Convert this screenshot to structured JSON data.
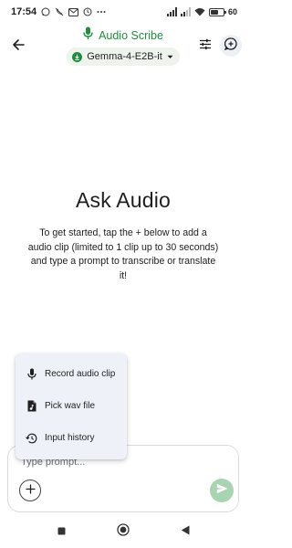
{
  "status_bar": {
    "time": "17:54",
    "battery_value": "60",
    "battery_level": 0.6,
    "icons": [
      "whatsapp-icon",
      "phone-off-icon",
      "gmail-icon",
      "clock-icon",
      "more-dots-icon",
      "signal-icon",
      "signal-icon",
      "wifi-icon",
      "battery-icon"
    ]
  },
  "header": {
    "app_title": "Audio Scribe",
    "model_name": "Gemma-4-E2B-it",
    "back_icon": "arrow-back-icon",
    "title_icon": "mic-icon",
    "model_icon": "download-icon",
    "dropdown_icon": "caret-down-icon",
    "tune_icon": "tune-icon",
    "new_chat_icon": "add-comment-icon"
  },
  "main": {
    "heading": "Ask Audio",
    "description": "To get started, tap the + below to add a audio clip (limited to 1 clip up to 30 seconds) and type a prompt to transcribe or translate it!"
  },
  "popup_menu": {
    "items": [
      {
        "label": "Record audio clip",
        "icon": "mic-icon"
      },
      {
        "label": "Pick wav file",
        "icon": "audio-file-icon"
      },
      {
        "label": "Input history",
        "icon": "history-icon"
      }
    ]
  },
  "input": {
    "placeholder": "Type prompt...",
    "value": "",
    "add_icon": "plus-icon",
    "send_icon": "send-icon"
  },
  "nav_bar": {
    "items": [
      "recents-square-icon",
      "home-circle-icon",
      "back-triangle-icon"
    ]
  },
  "colors": {
    "accent": "#1e8e3e",
    "send_button": "#a8d5b1",
    "popup_bg": "#eef1f8",
    "chip_bg": "#eef3ee"
  }
}
